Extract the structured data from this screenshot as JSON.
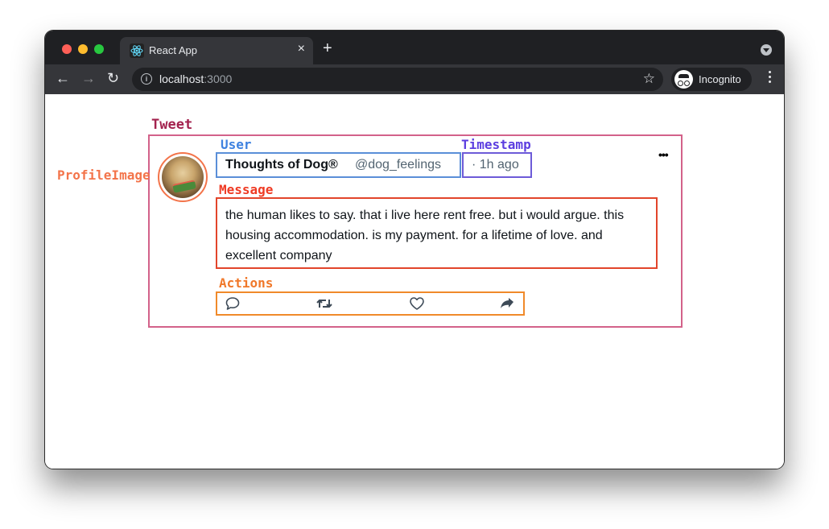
{
  "browser": {
    "tab_title": "React App",
    "tab_close": "×",
    "new_tab": "+",
    "url_host": "localhost",
    "url_port": ":3000",
    "incognito_label": "Incognito",
    "nav": {
      "back": "←",
      "forward": "→",
      "reload": "↻"
    },
    "star": "☆",
    "info": "i"
  },
  "annotations": {
    "tweet": "Tweet",
    "profile_image": "ProfileImage",
    "user": "User",
    "timestamp": "Timestamp",
    "message": "Message",
    "actions": "Actions"
  },
  "tweet": {
    "user_name": "Thoughts of Dog®",
    "user_handle": "@dog_feelings",
    "timestamp": "· 1h ago",
    "more": "•••",
    "message": "the human likes to say. that i live here rent free. but i would argue. this housing accommodation. is my payment. for a lifetime of love. and excellent company",
    "actions": [
      "reply",
      "retweet",
      "like",
      "share"
    ]
  },
  "colors": {
    "tweet_border": "#d3628a",
    "profile_border": "#f3744a",
    "user_border": "#5a8fd8",
    "timestamp_border": "#6d5bd8",
    "message_border": "#e2452b",
    "actions_border": "#f08a2a"
  }
}
